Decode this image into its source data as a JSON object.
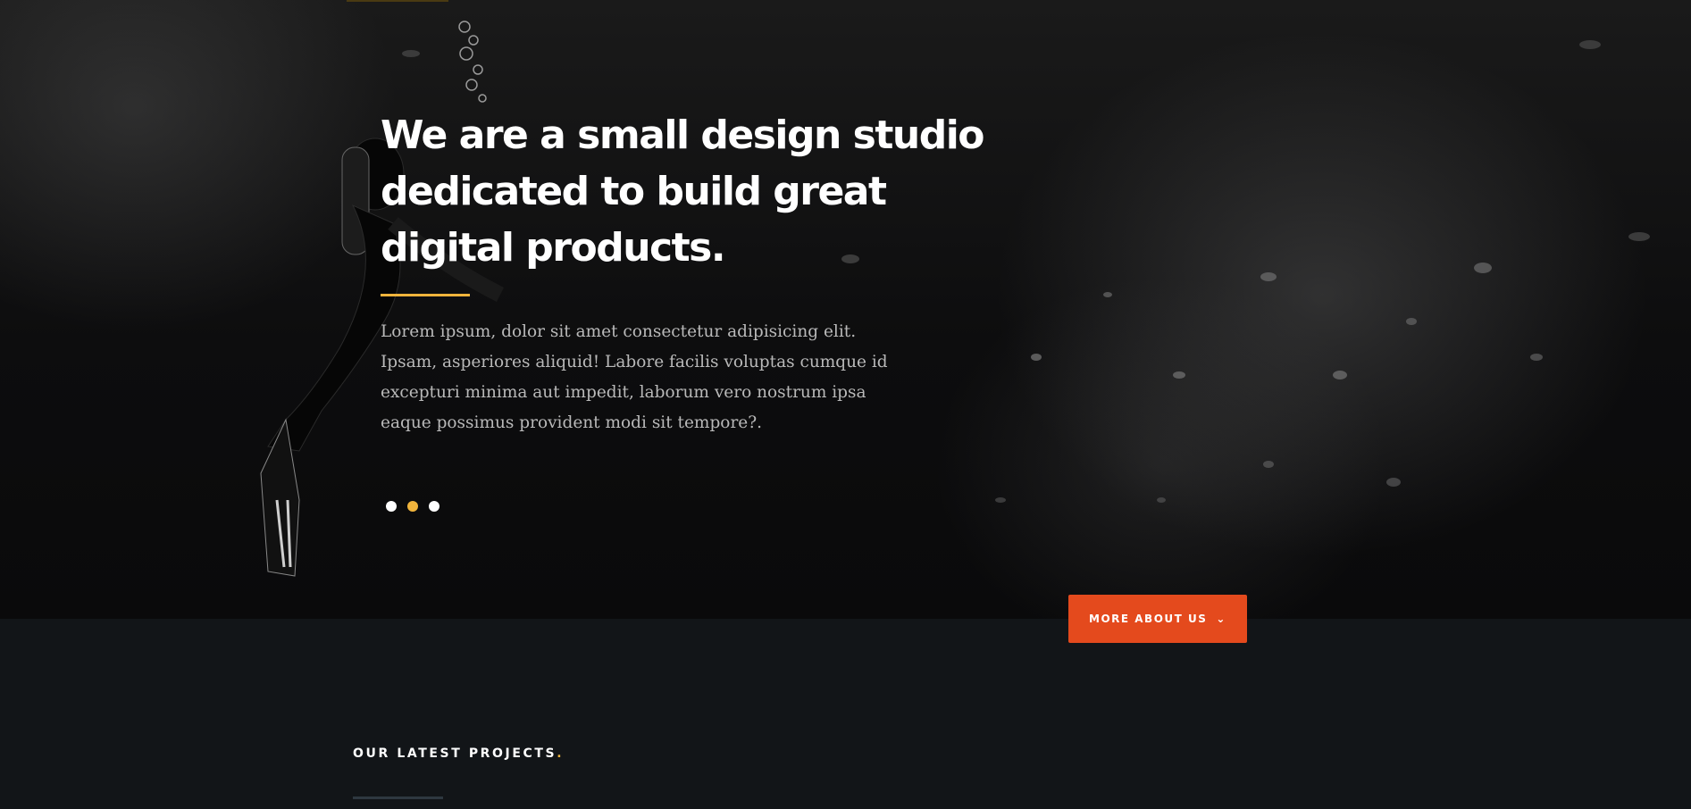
{
  "hero": {
    "title": "We are a small design studio dedicated to build great digital products.",
    "text": "Lorem ipsum, dolor sit amet consectetur adipisicing elit. Ipsam, asperiores aliquid! Labore facilis voluptas cumque id excepturi minima aut impedit, laborum vero nostrum ipsa eaque possimus provident modi sit tempore?.",
    "slides": {
      "count": 3,
      "active_index": 1
    },
    "cta": {
      "label": "MORE ABOUT US",
      "icon": "chevron-down-icon"
    }
  },
  "projects": {
    "heading": "OUR LATEST PROJECTS",
    "heading_accent": "."
  },
  "colors": {
    "accent_yellow": "#f0b43c",
    "button_orange": "#e44a1d",
    "section_bg": "#121518"
  }
}
